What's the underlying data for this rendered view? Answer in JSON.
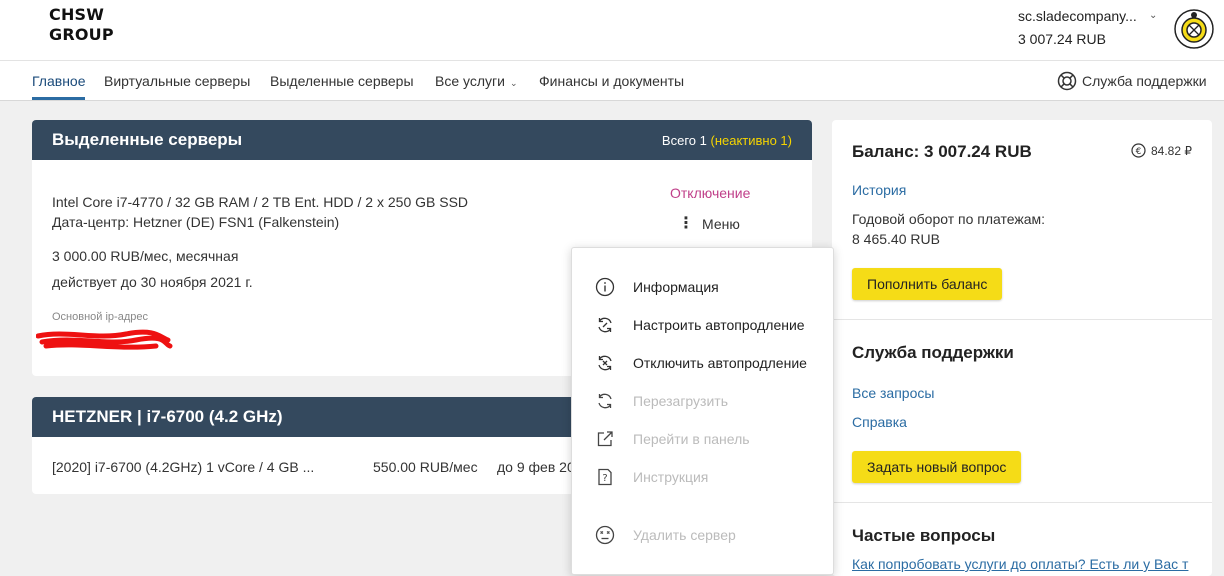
{
  "header": {
    "logo_line1": "CHSW",
    "logo_line2": "GROUP",
    "account_name": "sc.sladecompany...",
    "account_balance": "3 007.24 RUB"
  },
  "nav": {
    "items": [
      {
        "label": "Главное",
        "active": true
      },
      {
        "label": "Виртуальные серверы"
      },
      {
        "label": "Выделенные серверы"
      },
      {
        "label": "Все услуги"
      },
      {
        "label": "Финансы и документы"
      }
    ],
    "support": "Служба поддержки"
  },
  "dedicated": {
    "title": "Выделенные серверы",
    "total_label": "Всего 1",
    "inactive_label": "(неактивно 1)",
    "server": {
      "spec": "Intel Core i7-4770 / 32 GB RAM / 2 TB Ent. HDD / 2 x 250 GB SSD",
      "datacenter": "Дата-центр: Hetzner (DE) FSN1 (Falkenstein)",
      "price": "3 000.00 RUB/мес, месячная",
      "valid_until": "действует до 30 ноября 2021 г.",
      "ip_label": "Основной ip-адрес",
      "status": "Отключение",
      "menu_label": "Меню"
    }
  },
  "hetzner": {
    "title": "HETZNER | i7-6700 (4.2 GHz)",
    "row": {
      "name": "[2020] i7-6700 (4.2GHz) 1 vCore / 4 GB ...",
      "price": "550.00 RUB/мес",
      "until": "до 9 фев 20"
    }
  },
  "dropdown": {
    "items": [
      {
        "label": "Информация",
        "icon": "info-icon",
        "disabled": false
      },
      {
        "label": "Настроить автопродление",
        "icon": "autorenew-settings-icon",
        "disabled": false
      },
      {
        "label": "Отключить автопродление",
        "icon": "autorenew-off-icon",
        "disabled": false
      },
      {
        "label": "Перезагрузить",
        "icon": "reload-icon",
        "disabled": true
      },
      {
        "label": "Перейти в панель",
        "icon": "external-link-icon",
        "disabled": true
      },
      {
        "label": "Инструкция",
        "icon": "instruction-icon",
        "disabled": true
      },
      {
        "label": "Удалить сервер",
        "icon": "delete-server-icon",
        "disabled": true
      }
    ]
  },
  "sidebar": {
    "balance_title": "Баланс: 3 007.24 RUB",
    "bonus": "84.82 ₽",
    "history": "История",
    "turnover_label": "Годовой оборот по платежам:",
    "turnover_value": "8 465.40 RUB",
    "topup_button": "Пополнить баланс",
    "support_title": "Служба поддержки",
    "all_requests": "Все запросы",
    "help": "Справка",
    "new_question_button": "Задать новый вопрос",
    "faq_title": "Частые вопросы",
    "faq_first": "Как попробовать услуги до оплаты? Есть ли у Вас т"
  },
  "colors": {
    "header_dark": "#34495e",
    "accent_yellow": "#f5dc17",
    "link_blue": "#2b6ca3",
    "status_pink": "#c0408a"
  }
}
